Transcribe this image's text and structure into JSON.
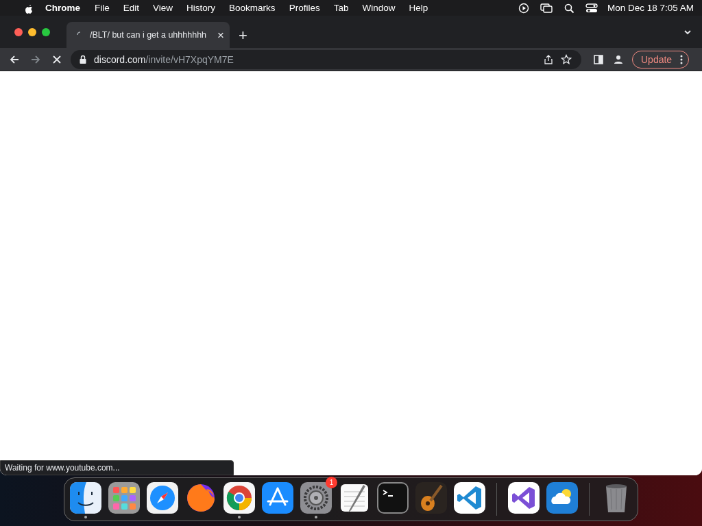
{
  "menu_bar": {
    "app_name": "Chrome",
    "items": [
      "File",
      "Edit",
      "View",
      "History",
      "Bookmarks",
      "Profiles",
      "Tab",
      "Window",
      "Help"
    ],
    "clock": "Mon Dec 18  7:05 AM"
  },
  "tabs": [
    {
      "title": "/BLT/ but can i get a uhhhhhhh",
      "selected": true,
      "loading": true,
      "close": "×"
    }
  ],
  "new_tab": "+",
  "toolbar": {
    "url_host": "discord.com",
    "url_path": "/invite/vH7XpqYM7E",
    "loading": true,
    "update_button": "Update"
  },
  "status_bubble": "Waiting for www.youtube.com...",
  "dock": {
    "sections": [
      {
        "items": [
          {
            "kind": "finder",
            "running": true
          },
          {
            "kind": "launchpad",
            "running": false
          },
          {
            "kind": "safari",
            "running": false
          },
          {
            "kind": "firefox",
            "running": false
          },
          {
            "kind": "chrome",
            "running": true
          },
          {
            "kind": "appstore",
            "running": false
          },
          {
            "kind": "settings",
            "running": true,
            "badge": "1"
          },
          {
            "kind": "textedit",
            "running": false
          },
          {
            "kind": "terminal",
            "running": false
          },
          {
            "kind": "garageband",
            "running": false
          },
          {
            "kind": "vscode",
            "running": false
          }
        ]
      },
      {
        "items": [
          {
            "kind": "visualstudio",
            "running": false
          },
          {
            "kind": "weather",
            "running": false
          }
        ]
      },
      {
        "items": [
          {
            "kind": "trash",
            "running": false
          }
        ]
      }
    ]
  }
}
